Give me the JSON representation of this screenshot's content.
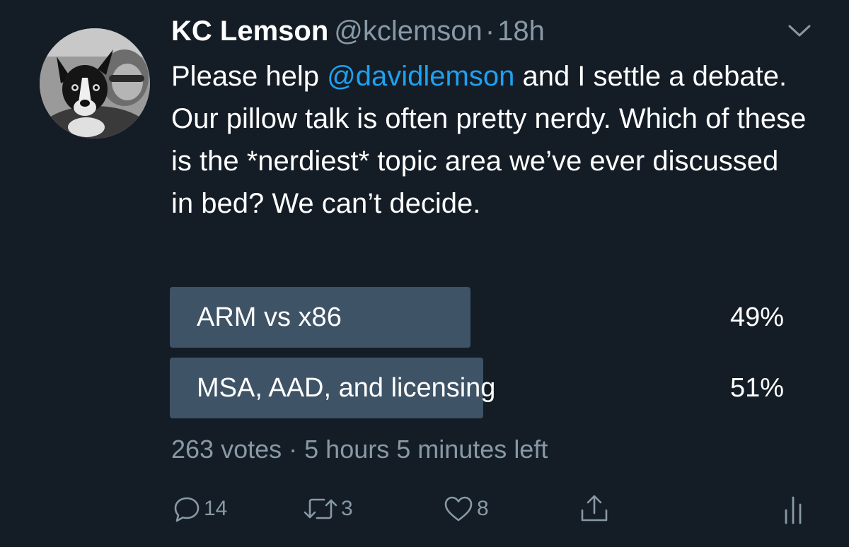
{
  "tweet": {
    "author_name": "KC Lemson",
    "handle": "@kclemson",
    "separator": "·",
    "time": "18h",
    "text_before_mention": "Please help ",
    "mention": "@davidlemson",
    "text_after_mention": " and I settle a debate. Our pillow talk is often pretty nerdy. Which of these is the *nerdiest* topic area we’ve ever discussed in bed? We can’t decide."
  },
  "poll": {
    "options": [
      {
        "label": "ARM vs x86",
        "percent_text": "49%",
        "percent": 49
      },
      {
        "label": "MSA, AAD, and licensing",
        "percent_text": "51%",
        "percent": 51
      }
    ],
    "votes_text": "263 votes",
    "meta_separator": "·",
    "time_left": "5 hours 5 minutes left"
  },
  "actions": {
    "reply_count": "14",
    "retweet_count": "3",
    "like_count": "8"
  },
  "icons": {
    "menu": "chevron-down-icon",
    "reply": "reply-icon",
    "retweet": "retweet-icon",
    "like": "heart-icon",
    "share": "share-icon",
    "analytics": "analytics-icon"
  },
  "colors": {
    "background": "#141d26",
    "mention": "#1da1f2",
    "muted": "#8899a6",
    "poll_bar": "#3e5366"
  }
}
